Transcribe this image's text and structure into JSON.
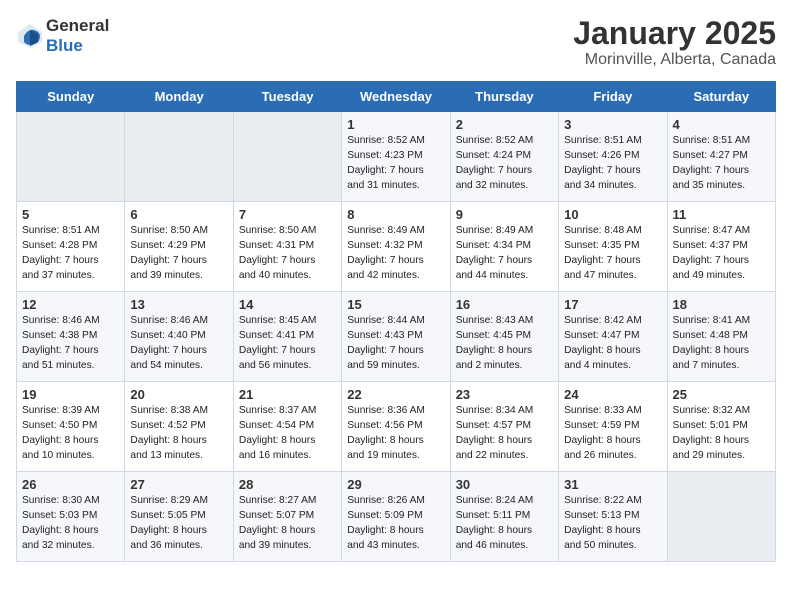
{
  "header": {
    "logo_general": "General",
    "logo_blue": "Blue",
    "title": "January 2025",
    "subtitle": "Morinville, Alberta, Canada"
  },
  "days_of_week": [
    "Sunday",
    "Monday",
    "Tuesday",
    "Wednesday",
    "Thursday",
    "Friday",
    "Saturday"
  ],
  "weeks": [
    [
      {
        "day": "",
        "content": ""
      },
      {
        "day": "",
        "content": ""
      },
      {
        "day": "",
        "content": ""
      },
      {
        "day": "1",
        "content": "Sunrise: 8:52 AM\nSunset: 4:23 PM\nDaylight: 7 hours\nand 31 minutes."
      },
      {
        "day": "2",
        "content": "Sunrise: 8:52 AM\nSunset: 4:24 PM\nDaylight: 7 hours\nand 32 minutes."
      },
      {
        "day": "3",
        "content": "Sunrise: 8:51 AM\nSunset: 4:26 PM\nDaylight: 7 hours\nand 34 minutes."
      },
      {
        "day": "4",
        "content": "Sunrise: 8:51 AM\nSunset: 4:27 PM\nDaylight: 7 hours\nand 35 minutes."
      }
    ],
    [
      {
        "day": "5",
        "content": "Sunrise: 8:51 AM\nSunset: 4:28 PM\nDaylight: 7 hours\nand 37 minutes."
      },
      {
        "day": "6",
        "content": "Sunrise: 8:50 AM\nSunset: 4:29 PM\nDaylight: 7 hours\nand 39 minutes."
      },
      {
        "day": "7",
        "content": "Sunrise: 8:50 AM\nSunset: 4:31 PM\nDaylight: 7 hours\nand 40 minutes."
      },
      {
        "day": "8",
        "content": "Sunrise: 8:49 AM\nSunset: 4:32 PM\nDaylight: 7 hours\nand 42 minutes."
      },
      {
        "day": "9",
        "content": "Sunrise: 8:49 AM\nSunset: 4:34 PM\nDaylight: 7 hours\nand 44 minutes."
      },
      {
        "day": "10",
        "content": "Sunrise: 8:48 AM\nSunset: 4:35 PM\nDaylight: 7 hours\nand 47 minutes."
      },
      {
        "day": "11",
        "content": "Sunrise: 8:47 AM\nSunset: 4:37 PM\nDaylight: 7 hours\nand 49 minutes."
      }
    ],
    [
      {
        "day": "12",
        "content": "Sunrise: 8:46 AM\nSunset: 4:38 PM\nDaylight: 7 hours\nand 51 minutes."
      },
      {
        "day": "13",
        "content": "Sunrise: 8:46 AM\nSunset: 4:40 PM\nDaylight: 7 hours\nand 54 minutes."
      },
      {
        "day": "14",
        "content": "Sunrise: 8:45 AM\nSunset: 4:41 PM\nDaylight: 7 hours\nand 56 minutes."
      },
      {
        "day": "15",
        "content": "Sunrise: 8:44 AM\nSunset: 4:43 PM\nDaylight: 7 hours\nand 59 minutes."
      },
      {
        "day": "16",
        "content": "Sunrise: 8:43 AM\nSunset: 4:45 PM\nDaylight: 8 hours\nand 2 minutes."
      },
      {
        "day": "17",
        "content": "Sunrise: 8:42 AM\nSunset: 4:47 PM\nDaylight: 8 hours\nand 4 minutes."
      },
      {
        "day": "18",
        "content": "Sunrise: 8:41 AM\nSunset: 4:48 PM\nDaylight: 8 hours\nand 7 minutes."
      }
    ],
    [
      {
        "day": "19",
        "content": "Sunrise: 8:39 AM\nSunset: 4:50 PM\nDaylight: 8 hours\nand 10 minutes."
      },
      {
        "day": "20",
        "content": "Sunrise: 8:38 AM\nSunset: 4:52 PM\nDaylight: 8 hours\nand 13 minutes."
      },
      {
        "day": "21",
        "content": "Sunrise: 8:37 AM\nSunset: 4:54 PM\nDaylight: 8 hours\nand 16 minutes."
      },
      {
        "day": "22",
        "content": "Sunrise: 8:36 AM\nSunset: 4:56 PM\nDaylight: 8 hours\nand 19 minutes."
      },
      {
        "day": "23",
        "content": "Sunrise: 8:34 AM\nSunset: 4:57 PM\nDaylight: 8 hours\nand 22 minutes."
      },
      {
        "day": "24",
        "content": "Sunrise: 8:33 AM\nSunset: 4:59 PM\nDaylight: 8 hours\nand 26 minutes."
      },
      {
        "day": "25",
        "content": "Sunrise: 8:32 AM\nSunset: 5:01 PM\nDaylight: 8 hours\nand 29 minutes."
      }
    ],
    [
      {
        "day": "26",
        "content": "Sunrise: 8:30 AM\nSunset: 5:03 PM\nDaylight: 8 hours\nand 32 minutes."
      },
      {
        "day": "27",
        "content": "Sunrise: 8:29 AM\nSunset: 5:05 PM\nDaylight: 8 hours\nand 36 minutes."
      },
      {
        "day": "28",
        "content": "Sunrise: 8:27 AM\nSunset: 5:07 PM\nDaylight: 8 hours\nand 39 minutes."
      },
      {
        "day": "29",
        "content": "Sunrise: 8:26 AM\nSunset: 5:09 PM\nDaylight: 8 hours\nand 43 minutes."
      },
      {
        "day": "30",
        "content": "Sunrise: 8:24 AM\nSunset: 5:11 PM\nDaylight: 8 hours\nand 46 minutes."
      },
      {
        "day": "31",
        "content": "Sunrise: 8:22 AM\nSunset: 5:13 PM\nDaylight: 8 hours\nand 50 minutes."
      },
      {
        "day": "",
        "content": ""
      }
    ]
  ]
}
